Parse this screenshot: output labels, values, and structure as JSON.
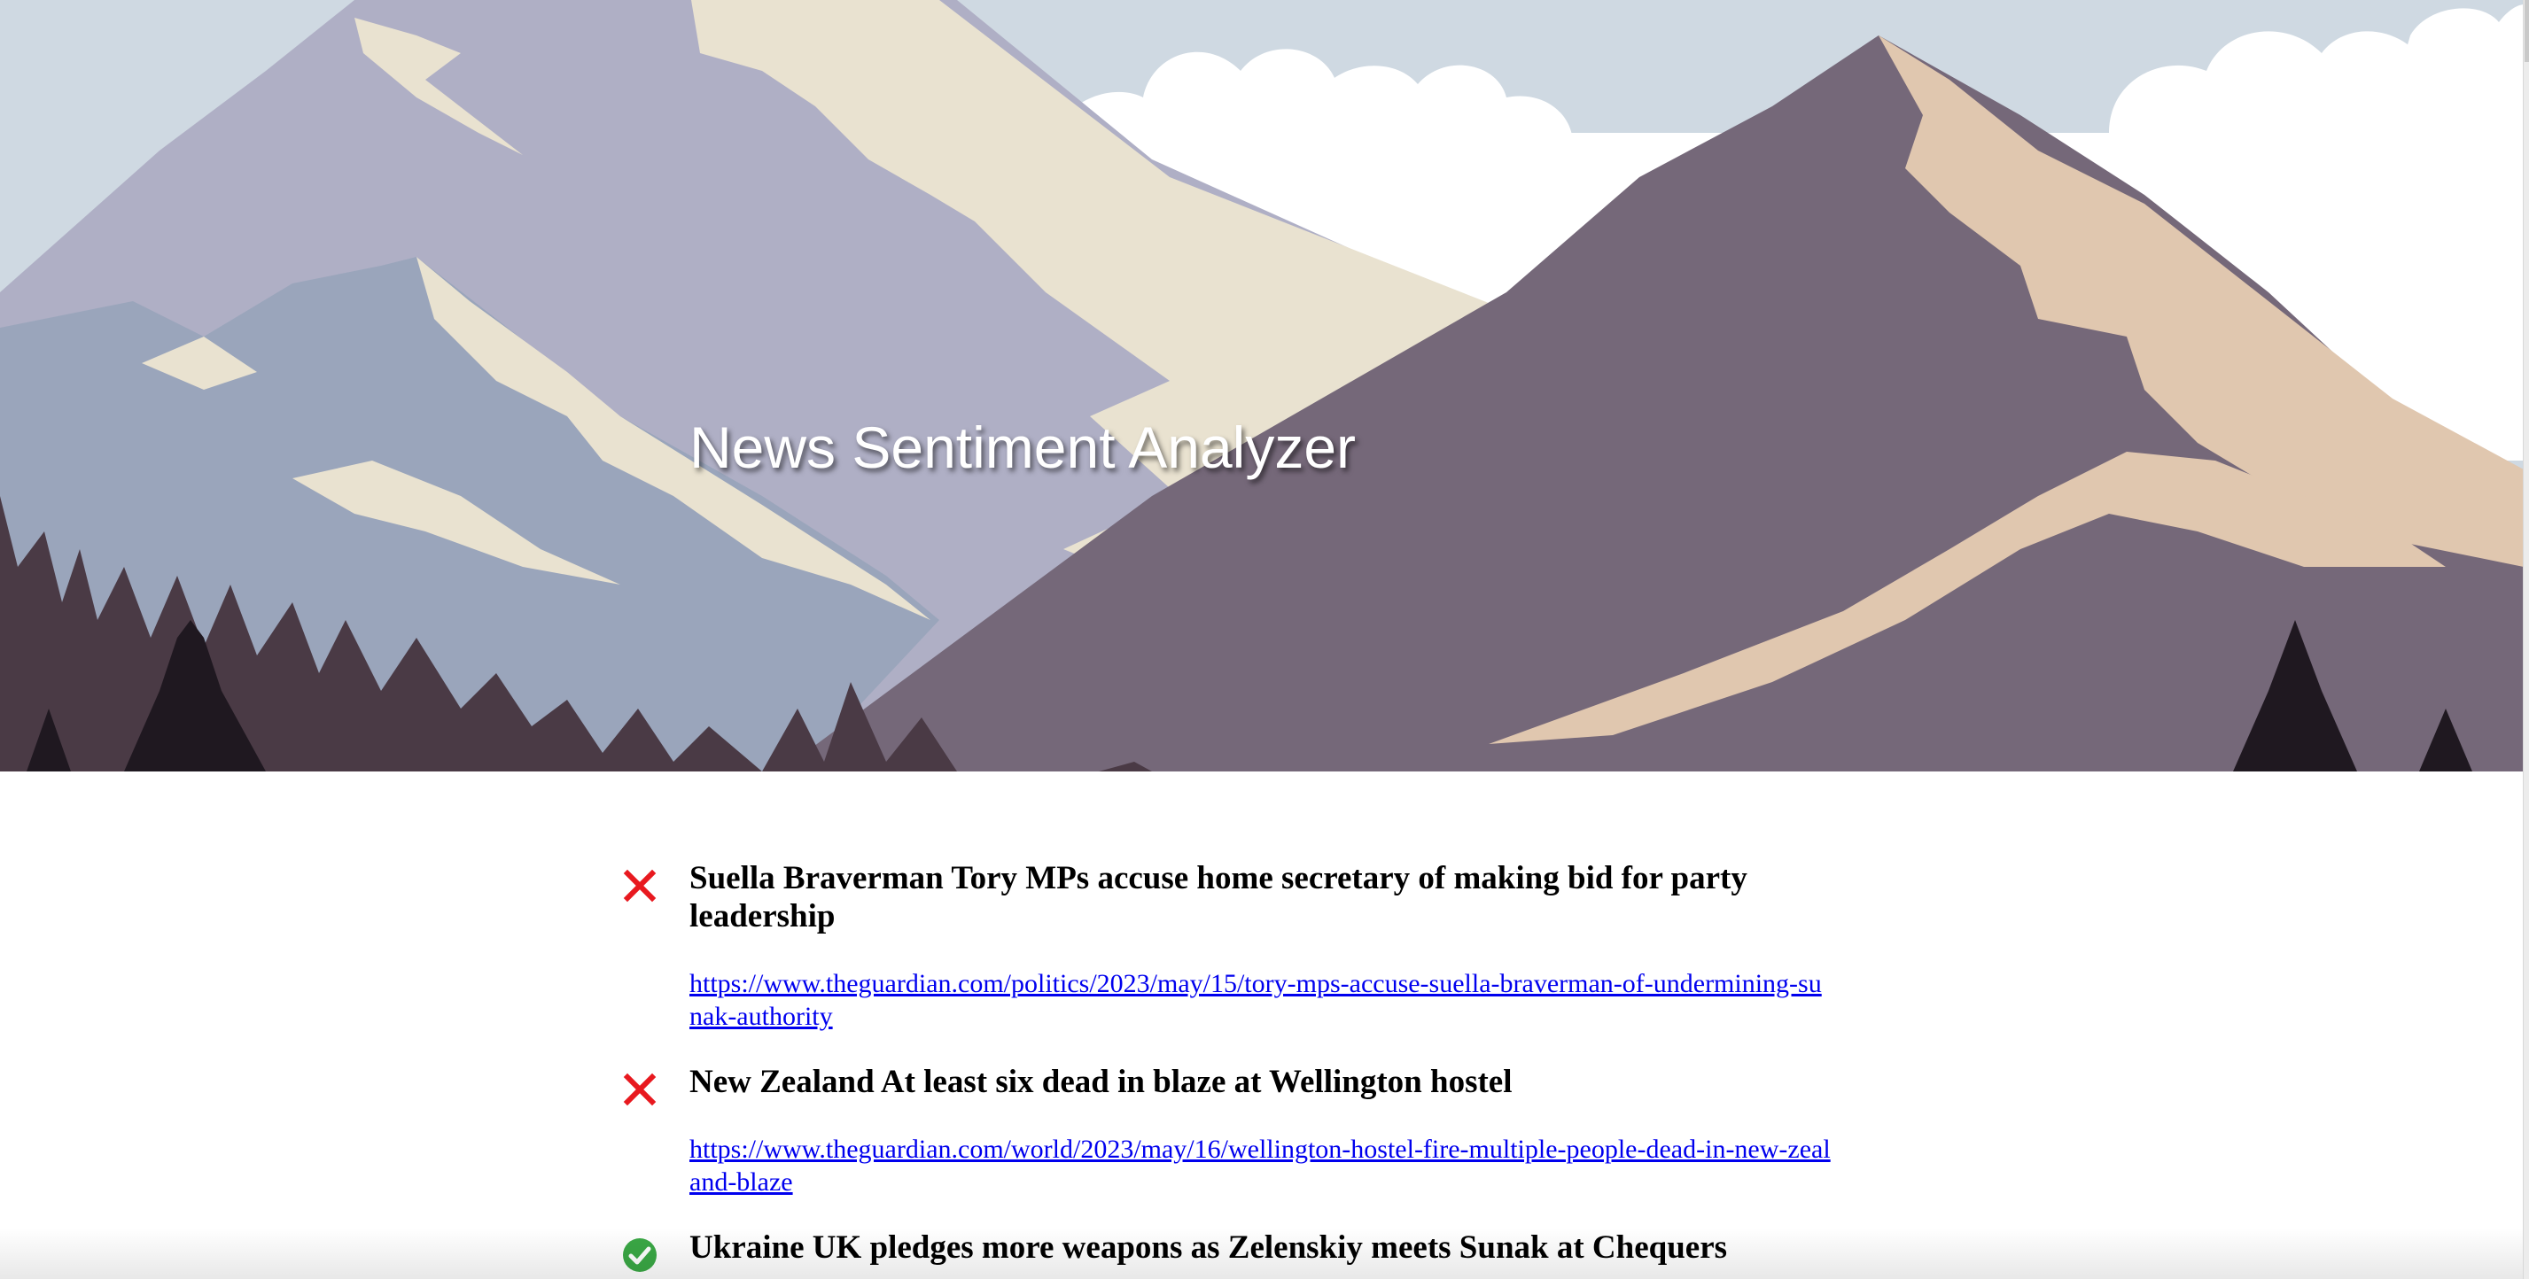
{
  "header": {
    "title": "News Sentiment Analyzer",
    "background": "mountain-landscape-illustration"
  },
  "colors": {
    "negative": "#e8191f",
    "positive": "#3aa845",
    "link": "#0000ee"
  },
  "articles": [
    {
      "sentiment": "negative",
      "icon": "cross-icon",
      "title": "Suella Braverman Tory MPs accuse home secretary of making bid for party leadership",
      "url": "https://www.theguardian.com/politics/2023/may/15/tory-mps-accuse-suella-braverman-of-undermining-sunak-authority"
    },
    {
      "sentiment": "negative",
      "icon": "cross-icon",
      "title": "New Zealand At least six dead in blaze at Wellington hostel",
      "url": "https://www.theguardian.com/world/2023/may/16/wellington-hostel-fire-multiple-people-dead-in-new-zealand-blaze"
    },
    {
      "sentiment": "positive",
      "icon": "check-circle-icon",
      "title": "Ukraine UK pledges more weapons as Zelenskiy meets Sunak at Chequers",
      "url": ""
    }
  ]
}
